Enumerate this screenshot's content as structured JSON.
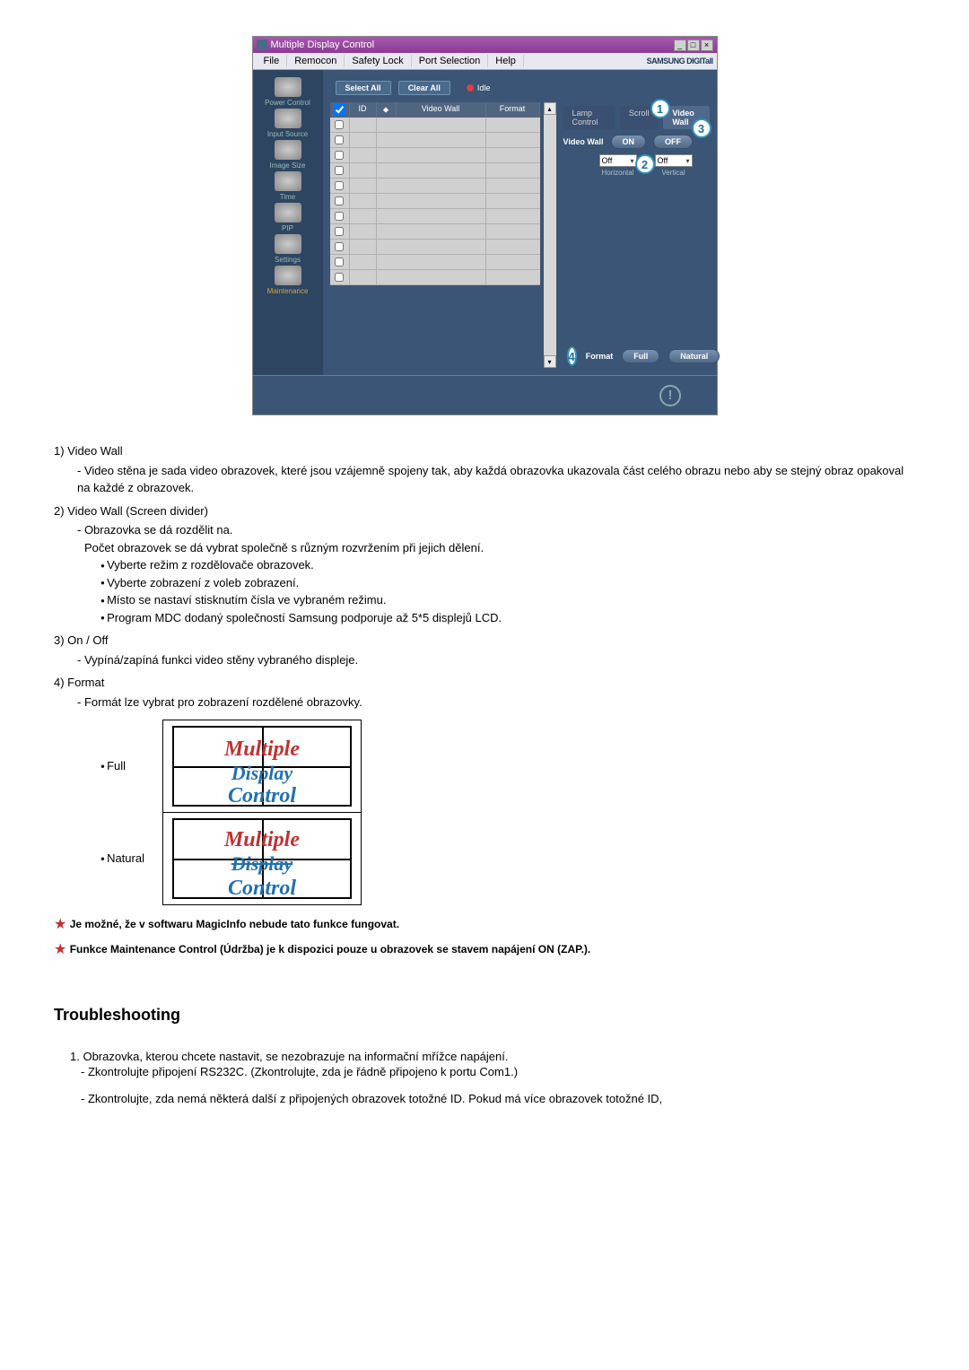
{
  "app": {
    "title": "Multiple Display Control",
    "brand": "SAMSUNG DIGITall",
    "menus": [
      "File",
      "Remocon",
      "Safety Lock",
      "Port Selection",
      "Help"
    ],
    "sidebar": [
      {
        "label": "Power Control"
      },
      {
        "label": "Input Source"
      },
      {
        "label": "Image Size"
      },
      {
        "label": "Time"
      },
      {
        "label": "PIP"
      },
      {
        "label": "Settings"
      },
      {
        "label": "Maintenance",
        "active": true
      }
    ],
    "toolbar": {
      "select_all": "Select All",
      "clear_all": "Clear All",
      "idle": "Idle"
    },
    "grid": {
      "headers": {
        "id": "ID",
        "videowall": "Video Wall",
        "format": "Format"
      },
      "row_count": 11
    },
    "right": {
      "tabs": [
        "Lamp Control",
        "Scroll",
        "Video Wall"
      ],
      "active_tab": 2,
      "video_wall_label": "Video Wall",
      "on": "ON",
      "off": "OFF",
      "horizontal": {
        "value": "Off",
        "label": "Horizontal"
      },
      "vertical": {
        "value": "Off",
        "label": "Vertical"
      },
      "format_label": "Format",
      "full": "Full",
      "natural": "Natural",
      "circles": {
        "c1": "1",
        "c2": "2",
        "c3": "3",
        "c4": "4"
      }
    }
  },
  "body": {
    "i1": {
      "num": "1) Video Wall",
      "sub": "- Video stěna je sada video obrazovek, které jsou vzájemně spojeny tak, aby každá obrazovka ukazovala část celého obrazu nebo aby se stejný obraz opakoval na každé z obrazovek."
    },
    "i2": {
      "num": "2) Video Wall (Screen divider)",
      "sub1": "- Obrazovka se dá rozdělit na.",
      "sub2": "Počet obrazovek se dá vybrat společně s různým rozvržením při jejich dělení.",
      "bullets": [
        "Vyberte režim z rozdělovače obrazovek.",
        "Vyberte zobrazení z voleb zobrazení.",
        "Místo se nastaví stisknutím čísla ve vybraném režimu.",
        "Program MDC dodaný společností Samsung podporuje až 5*5 displejů LCD."
      ]
    },
    "i3": {
      "num": "3) On / Off",
      "sub": "- Vypíná/zapíná funkci video stěny vybraného displeje."
    },
    "i4": {
      "num": "4) Format",
      "sub": "- Formát lze vybrat pro zobrazení rozdělené obrazovky.",
      "full_label": "Full",
      "natural_label": "Natural",
      "mdc1": "Multiple",
      "mdc2": "Display",
      "mdc3": "Control"
    },
    "note1": "Je možné, že v softwaru MagicInfo nebude tato funkce fungovat.",
    "note2": "Funkce Maintenance Control (Údržba) je k dispozici pouze u obrazovek se stavem napájení ON (ZAP.)."
  },
  "ts": {
    "heading": "Troubleshooting",
    "i1": "1. Obrazovka, kterou chcete nastavit, se nezobrazuje na informační mřížce napájení.",
    "s1": "- Zkontrolujte připojení RS232C. (Zkontrolujte, zda je řádně připojeno k portu Com1.)",
    "s2": "- Zkontrolujte, zda nemá některá další z připojených obrazovek totožné ID. Pokud má více obrazovek totožné ID,"
  }
}
